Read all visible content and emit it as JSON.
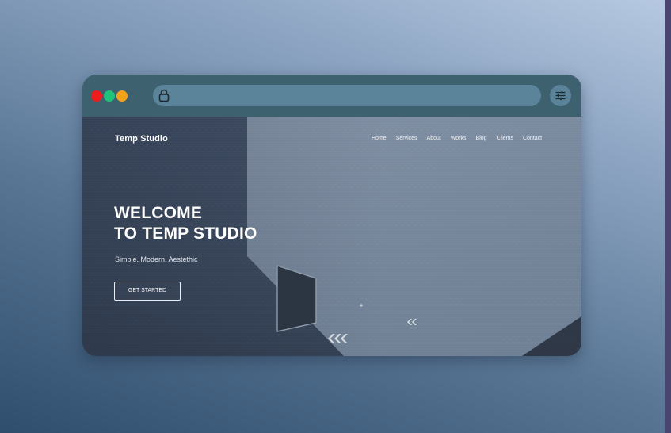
{
  "window": {
    "traffic_lights": [
      "close",
      "minimize",
      "maximize"
    ],
    "address_bar": {
      "icon": "lock-icon",
      "value": ""
    },
    "settings_icon": "sliders-icon"
  },
  "site": {
    "brand": "Temp Studio",
    "nav": [
      "Home",
      "Services",
      "About",
      "Works",
      "Blog",
      "Clients",
      "Contact"
    ],
    "hero": {
      "title_line1": "WELCOME",
      "title_line2": "TO TEMP STUDIO",
      "tagline": "Simple. Modern. Aestethic",
      "cta_label": "GET STARTED"
    }
  },
  "colors": {
    "close": "#ee1c1c",
    "minimize": "#1fc27a",
    "maximize": "#f2a21a",
    "toolbar": "#3e616f",
    "addressbar": "#5b8399"
  }
}
